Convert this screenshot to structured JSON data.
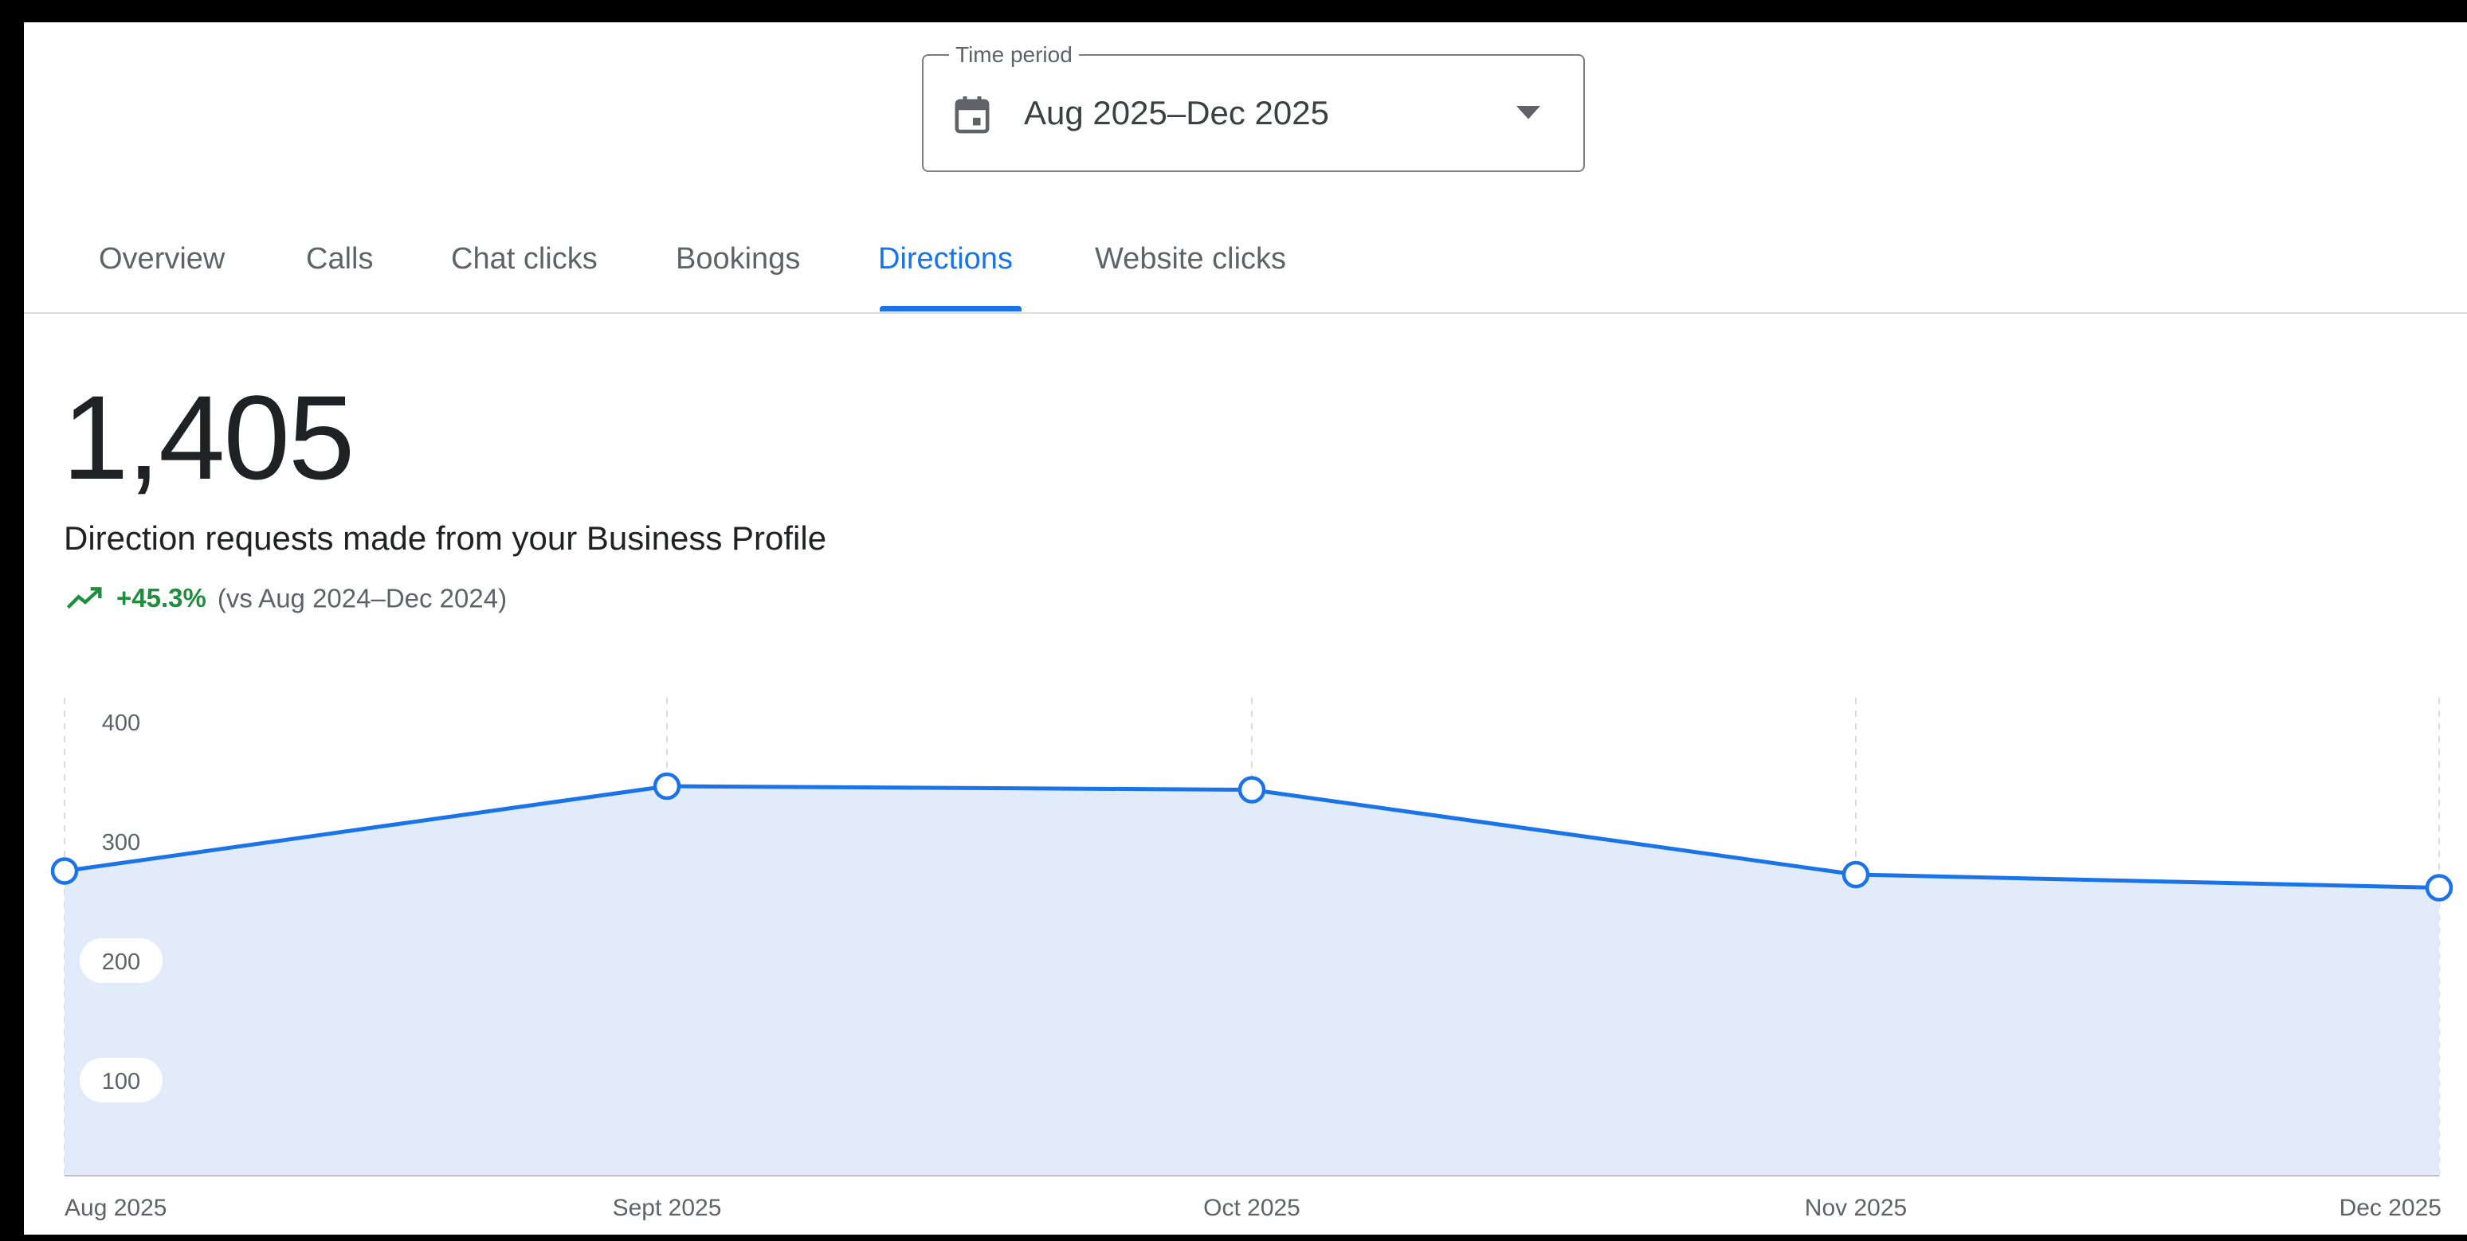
{
  "time_period": {
    "label": "Time period",
    "value": "Aug 2025–Dec 2025",
    "icon": "calendar-icon"
  },
  "tabs": [
    {
      "label": "Overview",
      "active": false
    },
    {
      "label": "Calls",
      "active": false
    },
    {
      "label": "Chat clicks",
      "active": false
    },
    {
      "label": "Bookings",
      "active": false
    },
    {
      "label": "Directions",
      "active": true
    },
    {
      "label": "Website clicks",
      "active": false
    }
  ],
  "metric": {
    "value": "1,405",
    "description": "Direction requests made from your Business Profile",
    "change": "+45.3%",
    "comparison": "(vs Aug 2024–Dec 2024)",
    "trend_icon": "trending-up-icon",
    "trend_color": "#1e8e3e"
  },
  "colors": {
    "accent": "#1a73e8",
    "area_fill": "#e2ebfa",
    "text_primary": "#202124",
    "text_secondary": "#5f6368"
  },
  "chart_data": {
    "type": "area",
    "categories": [
      "Aug 2025",
      "Sept 2025",
      "Oct 2025",
      "Nov 2025",
      "Dec 2025"
    ],
    "values": [
      255,
      326,
      323,
      252,
      241
    ],
    "y_ticks": [
      400,
      300,
      200,
      100
    ],
    "ylim": [
      0,
      400
    ],
    "title": "",
    "xlabel": "",
    "ylabel": "",
    "grid": "vertical dashed",
    "legend": "none"
  }
}
